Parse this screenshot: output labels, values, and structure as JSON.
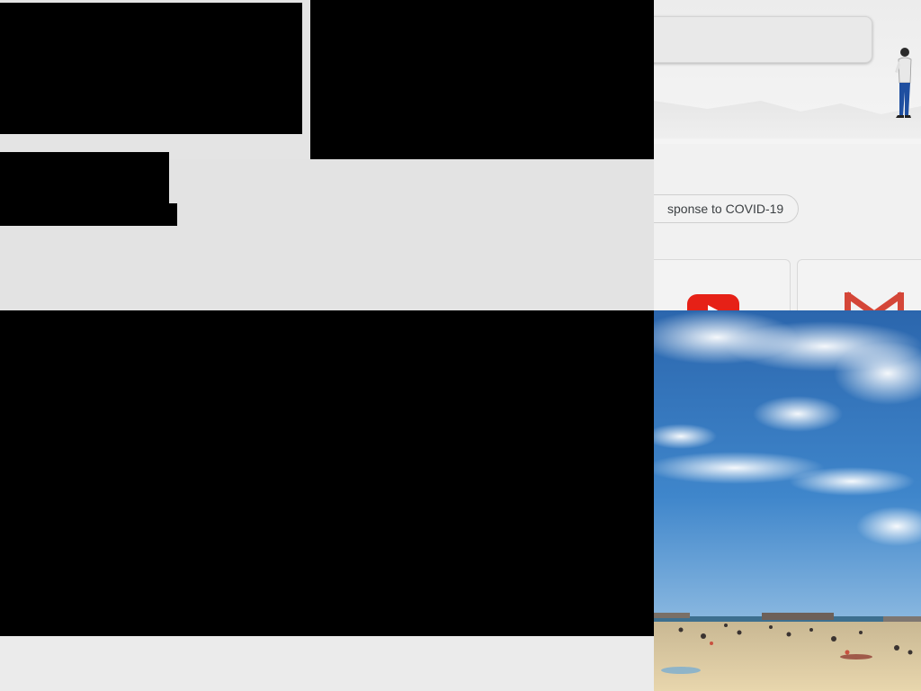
{
  "right_panel": {
    "search_box": {
      "placeholder": ""
    },
    "covid_chip": {
      "label": "sponse to COVID-19"
    },
    "shortcuts": [
      {
        "icon": "youtube-icon"
      },
      {
        "icon": "gmail-icon"
      }
    ]
  },
  "photo": {
    "subject": "beach-photo"
  },
  "colors": {
    "redaction": "#000000",
    "background": "#e4e4e4",
    "youtube_red": "#e62117",
    "gmail_red": "#d44638",
    "sky_blue": "#2f6fb6",
    "sand": "#e2cfa5"
  }
}
